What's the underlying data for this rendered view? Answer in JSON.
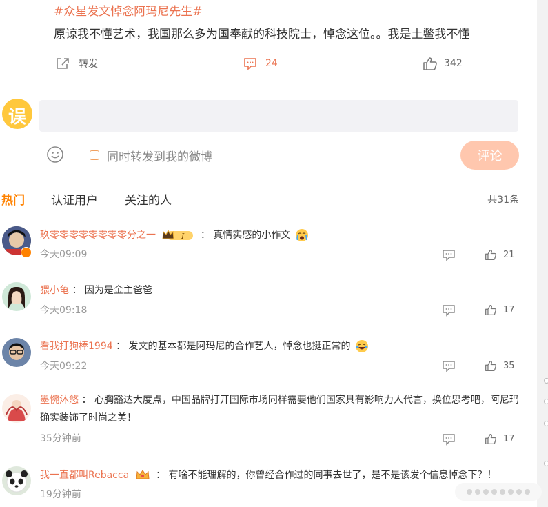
{
  "post": {
    "topic": "#众星发文悼念阿玛尼先生#",
    "text": "原谅我不懂艺术，我国那么多为国奉献的科技院士，悼念这位。。我是土鳖我不懂",
    "repost_label": "转发",
    "comment_count": "24",
    "like_count": "342"
  },
  "composer": {
    "avatar_glyph": "误",
    "placeholder": "",
    "also_repost_label": "同时转发到我的微博",
    "submit_label": "评论"
  },
  "tabs": {
    "hot": "热门",
    "verified": "认证用户",
    "following": "关注的人",
    "total": "共31条"
  },
  "comments": [
    {
      "name": "玖零零零零零零零零分之一",
      "sep": "：",
      "text": "真情实感的小作文",
      "time": "今天09:09",
      "likes": "21",
      "badge_text": "I"
    },
    {
      "name": "猥小龟",
      "sep": "：",
      "text": "因为是金主爸爸",
      "time": "今天09:18",
      "likes": "17"
    },
    {
      "name": "看我打狗棒1994",
      "sep": "：",
      "text": "发文的基本都是阿玛尼的合作艺人，悼念也挺正常的",
      "time": "今天09:22",
      "likes": "35"
    },
    {
      "name": "墨惋沐悠",
      "sep": "：",
      "text": "心胸豁达大度点，中国品牌打开国际市场同样需要他们国家具有影响力人代言，换位思考吧，阿尼玛确实装饰了时尚之美！",
      "time": "35分钟前",
      "likes": "17"
    },
    {
      "name": "我一直都叫Rebacca",
      "sep": "：",
      "text": "有啥不能理解的，你曾经合作过的同事去世了，是不是该发个信息悼念下？！",
      "time": "19分钟前"
    }
  ],
  "colors": {
    "accent": "#eb7350",
    "hot_tab": "#ff8200",
    "submit_bg": "#ffc7ae"
  }
}
